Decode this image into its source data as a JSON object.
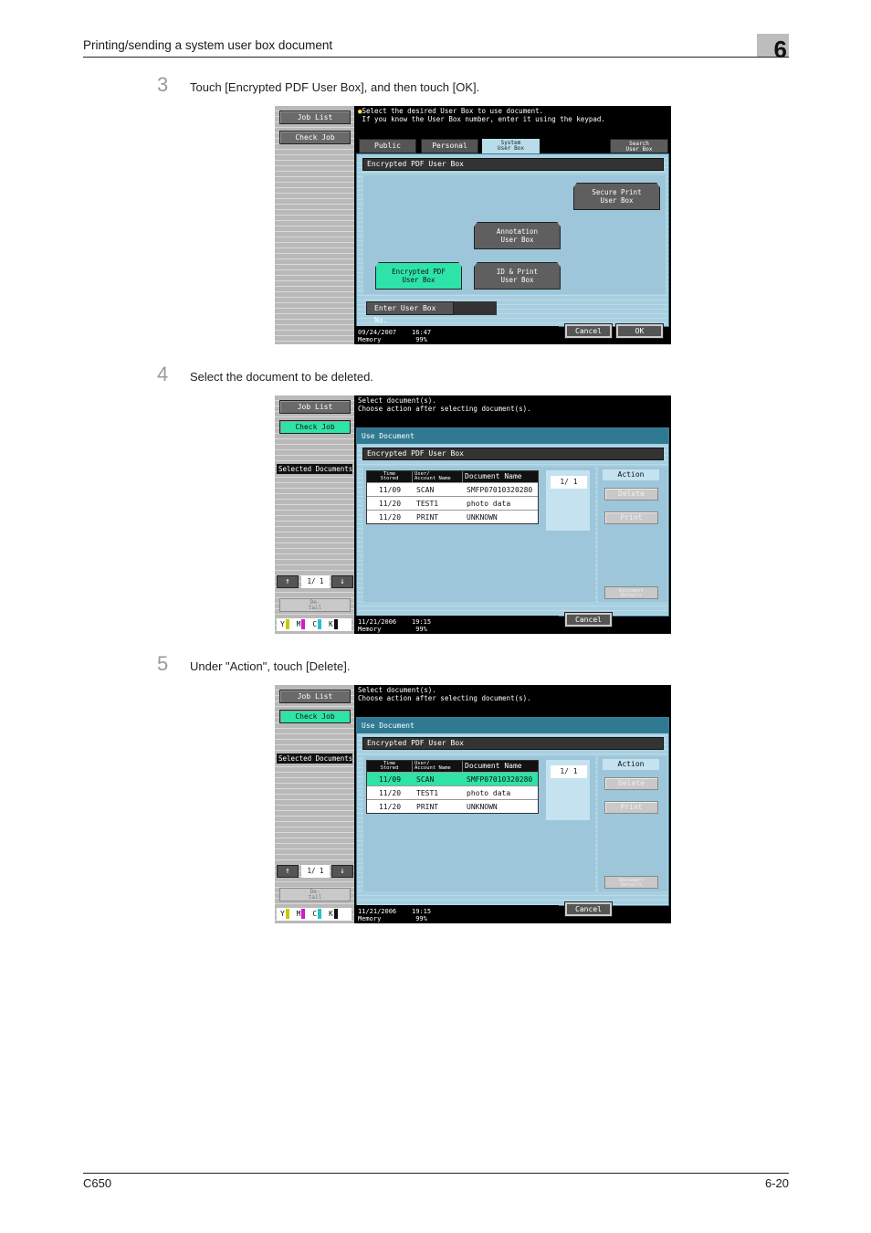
{
  "header": {
    "title": "Printing/sending a system user box document",
    "chapter": "6"
  },
  "footer": {
    "model": "C650",
    "page": "6-20"
  },
  "steps": [
    {
      "num": "3",
      "text": "Touch [Encrypted PDF User Box], and then touch [OK]."
    },
    {
      "num": "4",
      "text": "Select the document to be deleted."
    },
    {
      "num": "5",
      "text": "Under \"Action\", touch [Delete]."
    }
  ],
  "screen1": {
    "sidebar": {
      "job_list": "Job List",
      "check_job": "Check Job"
    },
    "message": "Select the desired User Box to use document.\n If you know the User Box number, enter it using the keypad.",
    "tabs": {
      "public": "Public",
      "personal": "Personal",
      "system": "System\nUser Box",
      "search": "Search\nUser Box"
    },
    "box_title": "Encrypted PDF User Box",
    "boxes": {
      "secure_print": "Secure Print\nUser Box",
      "annotation": "Annotation\nUser Box",
      "encrypted_pdf": "Encrypted PDF\nUser Box",
      "id_print": "ID & Print\nUser Box"
    },
    "enter_box_no": "Enter User Box No.",
    "enter_box_value": "",
    "status": "09/24/2007    16:47\nMemory         99%",
    "cancel": "Cancel",
    "ok": "OK"
  },
  "screen_doc": {
    "sidebar": {
      "job_list": "Job List",
      "check_job": "Check Job",
      "selected_documents": "Selected Documents",
      "up_arrow": "↑",
      "down_arrow": "↓",
      "page": "1/  1",
      "detail": "De-\ntail",
      "toner": [
        "Y",
        "M",
        "C",
        "K"
      ]
    },
    "message": "Select document(s).\nChoose action after selecting document(s).",
    "use_document": "Use Document",
    "box_title": "Encrypted PDF User Box",
    "table": {
      "headers": [
        "Time\nStored",
        "User/\nAccount Name",
        "Document Name"
      ],
      "rows": [
        {
          "time": "11/09",
          "user": "SCAN",
          "name": "SMFP07010320280"
        },
        {
          "time": "11/20",
          "user": "TEST1",
          "name": "photo data"
        },
        {
          "time": "11/20",
          "user": "PRINT",
          "name": "UNKNOWN"
        }
      ]
    },
    "page": "1/  1",
    "action": {
      "label": "Action",
      "delete": "Delete",
      "print": "Print",
      "document_details": "Document\nDetails"
    },
    "status": "11/21/2006    19:15\nMemory         99%",
    "cancel": "Cancel"
  },
  "colors": {
    "selection_green": "#2ee3a8",
    "panel_blue": "#a8cfe0",
    "header_teal": "#2f7a92"
  }
}
